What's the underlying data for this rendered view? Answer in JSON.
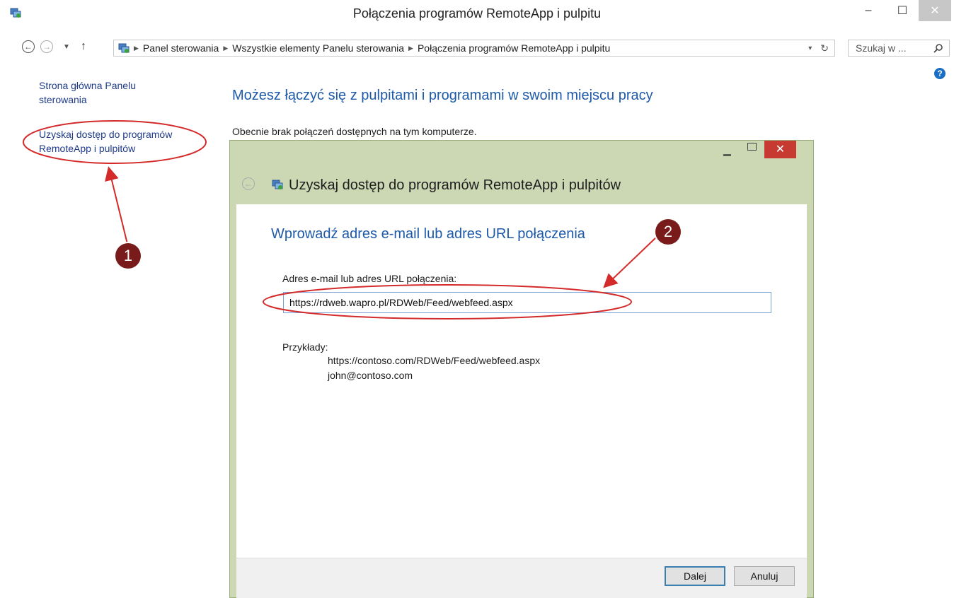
{
  "window": {
    "title": "Połączenia programów RemoteApp i pulpitu",
    "minimize": "–",
    "maximize": "☐",
    "close": "✕"
  },
  "address": {
    "crumbs": [
      "Panel sterowania",
      "Wszystkie elementy Panelu sterowania",
      "Połączenia programów RemoteApp i pulpitu"
    ],
    "search_placeholder": "Szukaj w ..."
  },
  "sidebar": {
    "home_link": "Strona główna Panelu sterowania",
    "access_link": "Uzyskaj dostęp do programów RemoteApp i pulpitów"
  },
  "main": {
    "heading": "Możesz łączyć się z pulpitami i programami w swoim miejscu pracy",
    "status": "Obecnie brak połączeń dostępnych na tym komputerze."
  },
  "dialog": {
    "title": "Uzyskaj dostęp do programów RemoteApp i pulpitów",
    "heading": "Wprowadź adres e-mail lub adres URL połączenia",
    "field_label": "Adres e-mail lub adres URL połączenia:",
    "field_value": "https://rdweb.wapro.pl/RDWeb/Feed/webfeed.aspx",
    "examples_label": "Przykłady:",
    "examples": [
      "https://contoso.com/RDWeb/Feed/webfeed.aspx",
      "john@contoso.com"
    ],
    "next_label": "Dalej",
    "cancel_label": "Anuluj"
  },
  "annotations": {
    "marker_1": "1",
    "marker_2": "2",
    "color": "#d42a2a"
  }
}
